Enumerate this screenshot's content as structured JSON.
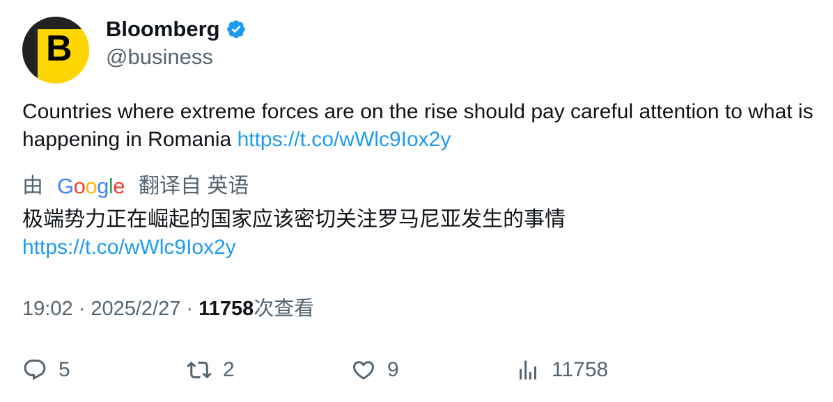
{
  "author": {
    "avatar_letter": "B",
    "display_name": "Bloomberg",
    "handle": "@business",
    "verified": true
  },
  "tweet": {
    "text": "Countries where extreme forces are on the rise should pay careful attention to what is happening in Romania ",
    "link": "https://t.co/wWlc9Iox2y"
  },
  "translation": {
    "by_label": "由",
    "provider": "Google",
    "from_label": "翻译自 英语",
    "text": "极端势力正在崛起的国家应该密切关注罗马尼亚发生的事情",
    "link": "https://t.co/wWlc9Iox2y"
  },
  "meta": {
    "time": "19:02",
    "separator": " · ",
    "date": "2025/2/27",
    "views_count": "11758",
    "views_label": "次查看"
  },
  "actions": {
    "replies": "5",
    "retweets": "2",
    "likes": "9",
    "views": "11758"
  },
  "colors": {
    "accent": "#1d9bf0",
    "secondary_text": "#536471",
    "avatar_bg": "#ffd500"
  }
}
